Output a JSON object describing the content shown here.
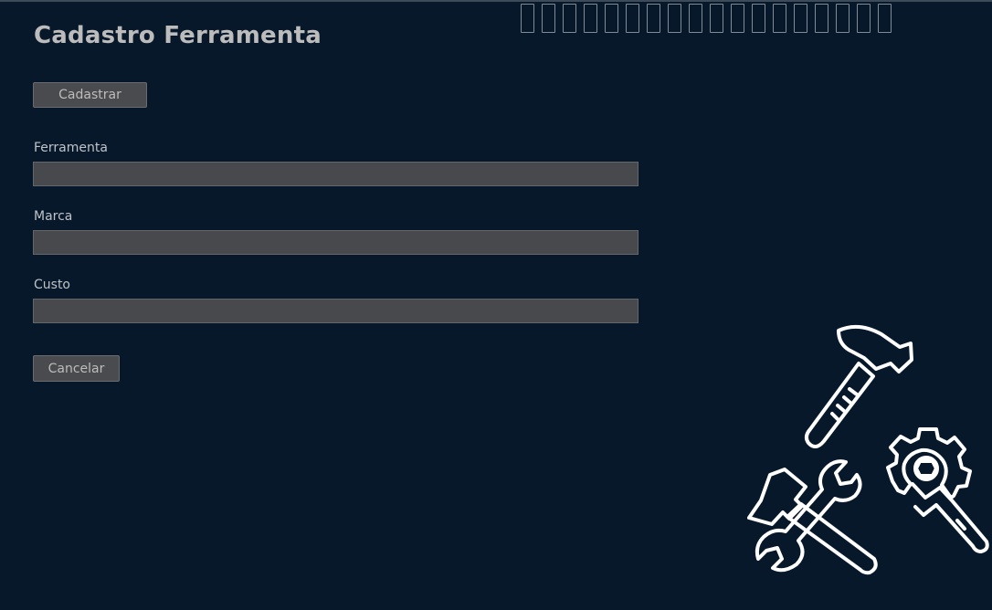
{
  "header": {
    "title": "Cadastro Ferramenta"
  },
  "actions": {
    "register_label": "Cadastrar",
    "cancel_label": "Cancelar"
  },
  "form": {
    "fields": [
      {
        "label": "Ferramenta",
        "value": ""
      },
      {
        "label": "Marca",
        "value": ""
      },
      {
        "label": "Custo",
        "value": ""
      }
    ]
  },
  "decorations": {
    "top_glyph_count": 18,
    "illustration": "tools-icon"
  },
  "colors": {
    "background": "#07182a",
    "field_bg": "#48494c",
    "button_bg": "#4a4b4e",
    "text": "#bcbcbc"
  }
}
